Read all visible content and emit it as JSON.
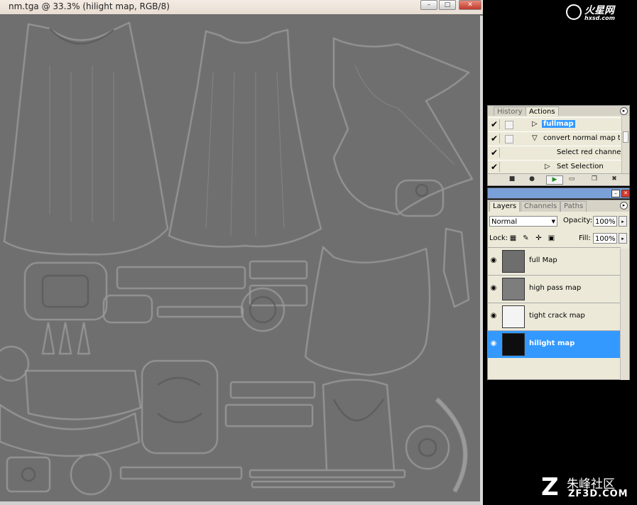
{
  "document": {
    "title": "nm.tga @ 33.3% (hilight map, RGB/8)",
    "window_buttons": {
      "minimize": "–",
      "maximize": "□",
      "close": "✕"
    }
  },
  "watermarks": {
    "top_brand": "火星网",
    "top_url": "hxsd.com",
    "bottom_logo": "Z",
    "bottom_brand": "朱峰社区",
    "bottom_url": "ZF3D.COM"
  },
  "actions_panel": {
    "tabs": [
      "History",
      "Actions"
    ],
    "active_tab": "Actions",
    "menu_glyph": "▸",
    "items": [
      {
        "check": "✔",
        "toggle": "▷",
        "label": "fullmap",
        "selected": true
      },
      {
        "check": "✔",
        "toggle": "▽",
        "label": "convert normal map t...",
        "selected": false
      },
      {
        "check": "✔",
        "toggle": "",
        "label": "Select red channel",
        "selected": false
      },
      {
        "check": "✔",
        "toggle": "▷",
        "label": "Set Selection",
        "selected": false
      }
    ],
    "toolbar": [
      "■",
      "●",
      "▶",
      "▭",
      "❐",
      "✖"
    ]
  },
  "layers_panel": {
    "header_buttons": {
      "minimize": "–",
      "close": "✕"
    },
    "tabs": [
      "Layers",
      "Channels",
      "Paths"
    ],
    "active_tab": "Layers",
    "menu_glyph": "▸",
    "blend_mode": "Normal",
    "opacity_label": "Opacity:",
    "opacity_value": "100%",
    "lock_label": "Lock:",
    "fill_label": "Fill:",
    "fill_value": "100%",
    "stepper_glyph": "▸",
    "lock_icons": [
      "▦",
      "✎",
      "✛",
      "▣"
    ],
    "layers": [
      {
        "eye": "◉",
        "name": "full Map",
        "thumb_color": "#6e6e6e",
        "selected": false
      },
      {
        "eye": "◉",
        "name": "high pass map",
        "thumb_color": "#7d7d7d",
        "selected": false
      },
      {
        "eye": "◉",
        "name": "tight crack map",
        "thumb_color": "#f4f4f4",
        "selected": false
      },
      {
        "eye": "◉",
        "name": "hilight map",
        "thumb_color": "#0e0e0e",
        "selected": true
      }
    ]
  },
  "colors": {
    "canvas": "#6f6f6f",
    "selection": "#3399ff",
    "panel": "#ece9d8"
  }
}
